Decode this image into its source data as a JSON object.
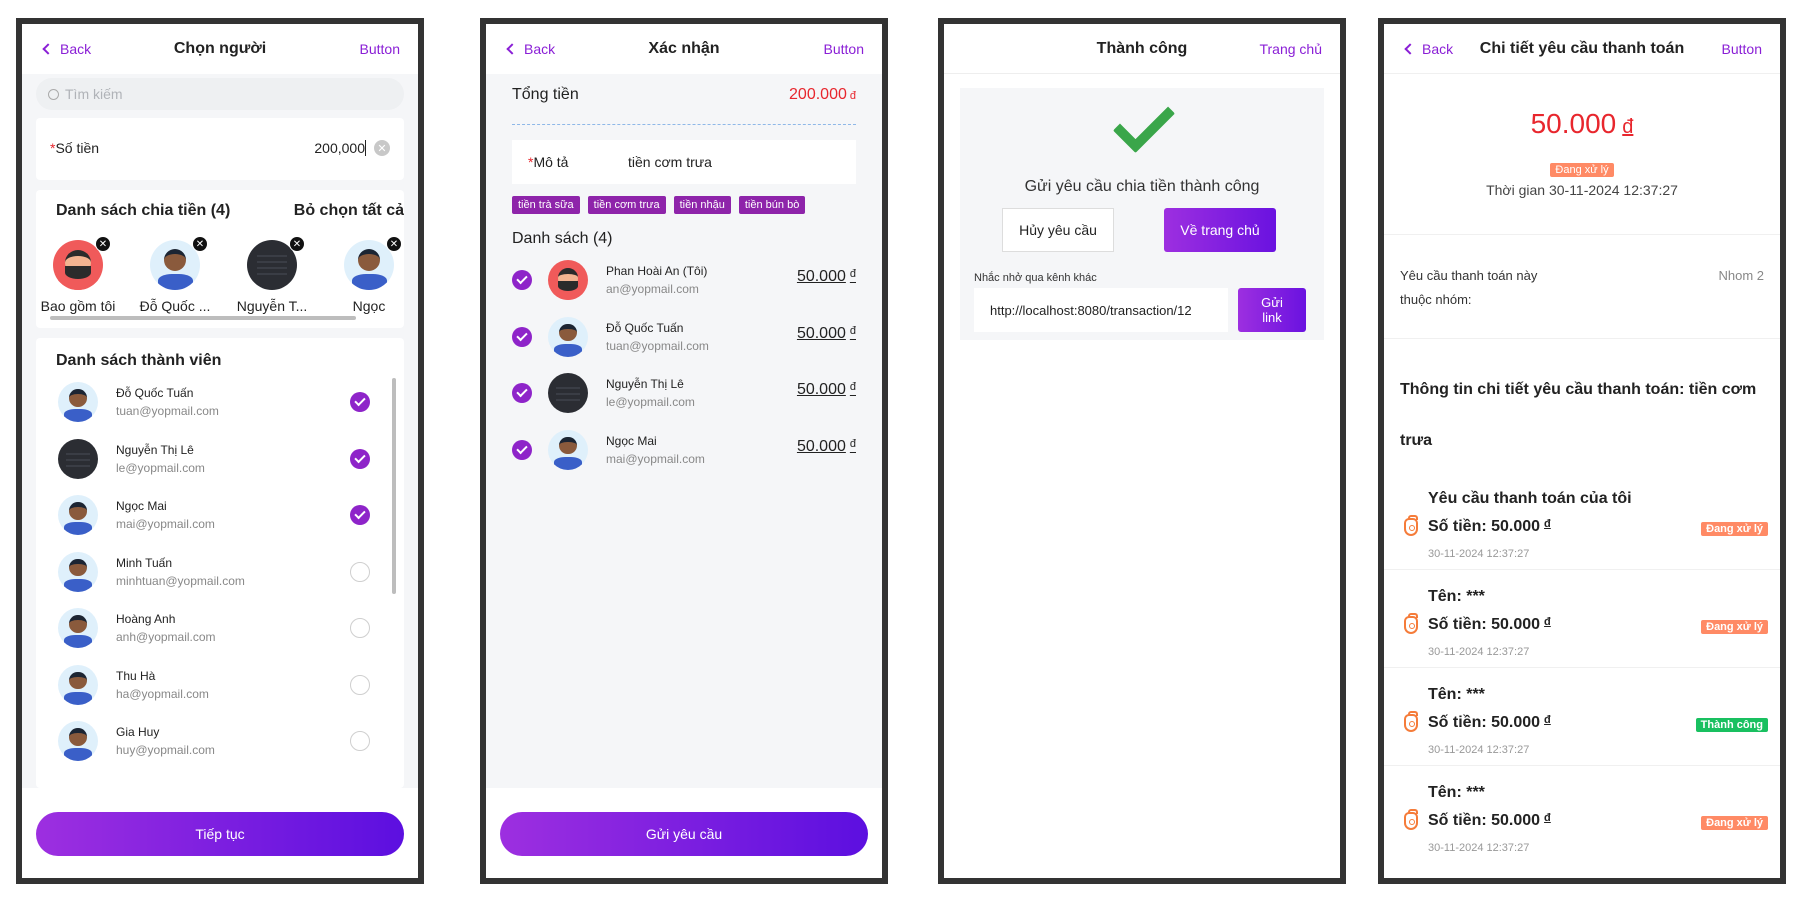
{
  "screen1": {
    "back": "Back",
    "title": "Chọn người",
    "right_button": "Button",
    "search_placeholder": "Tìm kiếm",
    "amount_label": "Số tiền",
    "amount_value": "200,000",
    "split_title": "Danh sách chia tiền (4)",
    "deselect_all": "Bỏ chọn tất cả",
    "split_people": [
      {
        "name": "Bao gồm tôi",
        "avatar": "red-bearded-avatar"
      },
      {
        "name": "Đỗ Quốc ...",
        "avatar": "boy-avatar"
      },
      {
        "name": "Nguyễn T...",
        "avatar": "dark-avatar"
      },
      {
        "name": "Ngọc",
        "avatar": "boy-avatar"
      }
    ],
    "members_title": "Danh sách thành viên",
    "members": [
      {
        "name": "Đỗ Quốc Tuấn",
        "email": "tuan@yopmail.com",
        "checked": true,
        "avatar": "boy-avatar"
      },
      {
        "name": "Nguyễn Thị Lê",
        "email": "le@yopmail.com",
        "checked": true,
        "avatar": "dark-avatar"
      },
      {
        "name": "Ngọc Mai",
        "email": "mai@yopmail.com",
        "checked": true,
        "avatar": "boy-avatar"
      },
      {
        "name": "Minh Tuấn",
        "email": "minhtuan@yopmail.com",
        "checked": false,
        "avatar": "boy-avatar"
      },
      {
        "name": "Hoàng Anh",
        "email": "anh@yopmail.com",
        "checked": false,
        "avatar": "boy-avatar"
      },
      {
        "name": "Thu Hà",
        "email": "ha@yopmail.com",
        "checked": false,
        "avatar": "boy-avatar"
      },
      {
        "name": "Gia Huy",
        "email": "huy@yopmail.com",
        "checked": false,
        "avatar": "boy-avatar"
      }
    ],
    "continue": "Tiếp tục"
  },
  "screen2": {
    "back": "Back",
    "title": "Xác nhận",
    "right_button": "Button",
    "total_label": "Tổng tiền",
    "total_value": "200.000",
    "currency": "đ",
    "desc_label": "Mô tả",
    "desc_value": "tiền cơm trưa",
    "tags": [
      "tiền trà sữa",
      "tiền cơm trưa",
      "tiền nhậu",
      "tiền bún bò"
    ],
    "list_title": "Danh sách (4)",
    "people": [
      {
        "name": "Phan Hoài An (Tôi)",
        "email": "an@yopmail.com",
        "amount": "50.000",
        "avatar": "red-bearded-avatar"
      },
      {
        "name": "Đỗ Quốc Tuấn",
        "email": "tuan@yopmail.com",
        "amount": "50.000",
        "avatar": "boy-avatar"
      },
      {
        "name": "Nguyễn Thị Lê",
        "email": "le@yopmail.com",
        "amount": "50.000",
        "avatar": "dark-avatar"
      },
      {
        "name": "Ngọc Mai",
        "email": "mai@yopmail.com",
        "amount": "50.000",
        "avatar": "boy-avatar"
      }
    ],
    "send": "Gửi yêu cầu"
  },
  "screen3": {
    "title": "Thành công",
    "right_button": "Trang chủ",
    "message": "Gửi yêu cầu chia tiền thành công",
    "cancel": "Hủy yêu cầu",
    "home": "Về trang chủ",
    "remind_label": "Nhắc nhở qua kênh khác",
    "link": "http://localhost:8080/transaction/12",
    "send_link_line1": "Gửi",
    "send_link_line2": "link"
  },
  "screen4": {
    "back": "Back",
    "title": "Chi tiết yêu cầu thanh toán",
    "right_button": "Button",
    "amount": "50.000",
    "currency": "đ",
    "status": "Đang xử lý",
    "time": "Thời gian 30-11-2024 12:37:27",
    "group_label": "Yêu cầu thanh toán này thuộc nhóm:",
    "group_value": "Nhom 2",
    "detail_title": "Thông tin chi tiết yêu cầu thanh toán: tiền cơm trưa",
    "requests": [
      {
        "title": "Yêu cầu thanh toán của tôi",
        "amount": "Số tiền: 50.000",
        "date": "30-11-2024 12:37:27",
        "status": "Đang xử lý",
        "status_color": "#ff8a65"
      },
      {
        "title": "Tên: ***",
        "amount": "Số tiền: 50.000",
        "date": "30-11-2024 12:37:27",
        "status": "Đang xử lý",
        "status_color": "#ff8a65"
      },
      {
        "title": "Tên: ***",
        "amount": "Số tiền: 50.000",
        "date": "30-11-2024 12:37:27",
        "status": "Thành công",
        "status_color": "#19c060"
      },
      {
        "title": "Tên: ***",
        "amount": "Số tiền: 50.000",
        "date": "30-11-2024 12:37:27",
        "status": "Đang xử lý",
        "status_color": "#ff8a65"
      }
    ]
  },
  "colors": {
    "accent": "#8a1fd6",
    "danger": "#e8262d",
    "success": "#3aa64a"
  }
}
